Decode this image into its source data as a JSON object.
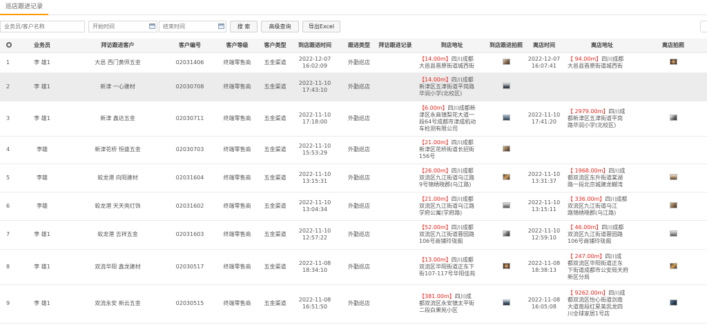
{
  "tab": {
    "label": "巡店跟进记录"
  },
  "toolbar": {
    "search_placeholder": "业务员/客户名称",
    "start_placeholder": "开始时间",
    "end_placeholder": "结束时间",
    "search_label": "搜 索",
    "advanced_label": "高级查询",
    "export_label": "导出Excel"
  },
  "columns": {
    "salesman": "业务员",
    "customer": "拜访跟进客户",
    "code": "客户编号",
    "level": "客户等级",
    "type": "客户类型",
    "arrive_time": "到店跟进时间",
    "follow_type": "跟进类型",
    "record": "拜访跟进记录",
    "arrive_addr": "到店地址",
    "arrive_photo": "到店跟进拍照",
    "leave_time": "离店时间",
    "leave_addr": "离店地址",
    "leave_photo": "离店拍照"
  },
  "rows": [
    {
      "no": "1",
      "salesman": "李 雄1",
      "customer": "大邑 西门黄师五金",
      "code": "02031406",
      "level": "终端零售商",
      "type": "五金渠道",
      "arrive_date": "2022-12-07",
      "arrive_clock": "16:02:09",
      "follow_type": "外勤巡店",
      "arrive_dist": "【14.00m】",
      "arrive_addr_a": "四川成都",
      "arrive_addr_b": "大邑县晋原街道城西街",
      "leave_date": "2022-12-07",
      "leave_clock": "16:07:41",
      "leave_dist": "【 94.00m】",
      "leave_addr_a": "四川成都",
      "leave_addr_b": "大邑县晋原街道城西街"
    },
    {
      "no": "2",
      "salesman": "李 雄1",
      "customer": "新津 一心建材",
      "code": "02030708",
      "level": "终端零售商",
      "type": "五金渠道",
      "arrive_date": "2022-11-10",
      "arrive_clock": "17:43:10",
      "follow_type": "外勤巡店",
      "arrive_dist": "【14.00m】",
      "arrive_addr_a": "四川成都",
      "arrive_addr_b": "新津区五津街道平岗路",
      "arrive_addr_c": "华润小学(北校区)"
    },
    {
      "no": "3",
      "salesman": "李 雄1",
      "customer": "新津 鑫达五金",
      "code": "02030711",
      "level": "终端零售商",
      "type": "五金渠道",
      "arrive_date": "2022-11-10",
      "arrive_clock": "17:18:00",
      "follow_type": "外勤巡店",
      "arrive_dist": "【6.00m】",
      "arrive_addr_a": "四川成都新",
      "arrive_addr_b": "津区永商镇梨花大道一",
      "arrive_addr_c": "段64号成都市津成机动",
      "arrive_addr_d": "车检测有限公司",
      "leave_date": "2022-11-10",
      "leave_clock": "17:41:20",
      "leave_dist": "【 2979.00m】",
      "leave_addr_a": "四川成",
      "leave_addr_b": "都新津区五津街道平岗",
      "leave_addr_c": "路华润小学(北校区)"
    },
    {
      "no": "4",
      "salesman": "李雄",
      "customer": "新津花桥 恒盛五金",
      "code": "02030703",
      "level": "终端零售商",
      "type": "五金渠道",
      "arrive_date": "2022-11-10",
      "arrive_clock": "15:53:29",
      "follow_type": "外勤巡店",
      "arrive_dist": "【21.00m】",
      "arrive_addr_a": "四川成都",
      "arrive_addr_b": "新津区花桥街道长招街",
      "arrive_addr_c": "156号"
    },
    {
      "no": "5",
      "salesman": "李雄",
      "customer": "蛟龙港 向阳建材",
      "code": "02031604",
      "level": "终端零售商",
      "type": "五金渠道",
      "arrive_date": "2022-11-10",
      "arrive_clock": "13:15:31",
      "follow_type": "外勤巡店",
      "arrive_dist": "【26.00m】",
      "arrive_addr_a": "四川成都",
      "arrive_addr_b": "双流区九江街道乌江路",
      "arrive_addr_c": "9号锦绣晓郡(乌江路)",
      "leave_date": "2022-11-10",
      "leave_clock": "13:31:37",
      "leave_dist": "【 1968.00m】",
      "leave_addr_a": "四川成",
      "leave_addr_b": "都双流区东升街道棠湖",
      "leave_addr_c": "路一段北京城建龙樾湾"
    },
    {
      "no": "6",
      "salesman": "李雄",
      "customer": "蛟龙港 天天亮灯饰",
      "code": "02031602",
      "level": "终端零售商",
      "type": "五金渠道",
      "arrive_date": "2022-11-10",
      "arrive_clock": "13:04:34",
      "follow_type": "外勤巡店",
      "arrive_dist": "【21.00m】",
      "arrive_addr_a": "四川成都",
      "arrive_addr_b": "双流区九江街道乌江路",
      "arrive_addr_c": "学府公寓(学府路)",
      "leave_date": "2022-11-10",
      "leave_clock": "13:15:11",
      "leave_dist": "【 336.00m】",
      "leave_addr_a": "四川成都",
      "leave_addr_b": "双流区九江街道乌江",
      "leave_addr_c": "路锦绣晓郡(乌江路)"
    },
    {
      "no": "7",
      "salesman": "李 雄1",
      "customer": "蛟龙港 吉祥五金",
      "code": "02031603",
      "level": "终端零售商",
      "type": "五金渠道",
      "arrive_date": "2022-11-10",
      "arrive_clock": "12:57:22",
      "follow_type": "外勤巡店",
      "arrive_dist": "【52.00m】",
      "arrive_addr_a": "四川成都",
      "arrive_addr_b": "双流区九江街道蓉园路",
      "arrive_addr_c": "106号商铺玲珑阁",
      "leave_date": "2022-11-10",
      "leave_clock": "12:59:10",
      "leave_dist": "【 46.00m】",
      "leave_addr_a": "四川成都",
      "leave_addr_b": "双流区九江街道蓉园路",
      "leave_addr_c": "106号商铺玲珑阁"
    },
    {
      "no": "8",
      "salesman": "李 雄1",
      "customer": "双流华阳 鑫龙建材",
      "code": "02030517",
      "level": "终端零售商",
      "type": "五金渠道",
      "arrive_date": "2022-11-08",
      "arrive_clock": "18:34:10",
      "follow_type": "外勤巡店",
      "arrive_dist": "【13.00m】",
      "arrive_addr_a": "四川成都",
      "arrive_addr_b": "双流区华阳街道正东下",
      "arrive_addr_c": "街107-117号华阳佳苑",
      "leave_date": "2022-11-08",
      "leave_clock": "18:38:13",
      "leave_dist": "【 247.00m】",
      "leave_addr_a": "四川成",
      "leave_addr_b": "都双流区华阳街道正东",
      "leave_addr_c": "下街道成都市公安局天府",
      "leave_addr_d": "新区分局"
    },
    {
      "no": "9",
      "salesman": "李 雄1",
      "customer": "双流永安 新云五金",
      "code": "02030515",
      "level": "终端零售商",
      "type": "五金渠道",
      "arrive_date": "2022-11-08",
      "arrive_clock": "16:51:50",
      "follow_type": "外勤巡店",
      "arrive_dist": "【381.00m】",
      "arrive_addr_a": "四川成",
      "arrive_addr_b": "都双流区永安镇太平街",
      "arrive_addr_c": "二段白果苑小区",
      "leave_date": "2022-11-08",
      "leave_clock": "16:05:08",
      "leave_dist": "【 9262.00m】",
      "leave_addr_a": "四川成",
      "leave_addr_b": "都双流区怡心街道剑南",
      "leave_addr_c": "大道南段红星美凯龙四",
      "leave_addr_d": "川全球家居1号店"
    }
  ]
}
